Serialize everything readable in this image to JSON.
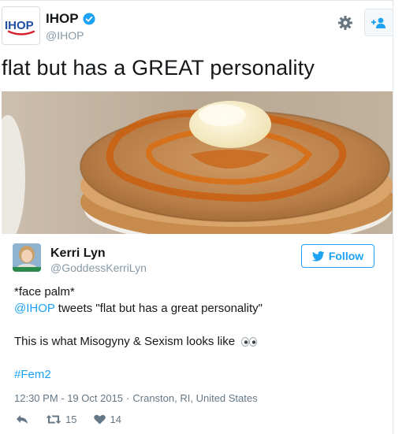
{
  "tweet": {
    "author_name": "IHOP",
    "author_handle": "@IHOP",
    "logo_text": "IHOP",
    "text": "flat but has a GREAT personality",
    "image": "pancake stack with syrup and butter",
    "icons": {
      "settings": "gear-icon",
      "follow": "follow-user-icon",
      "verified": "verified-badge-icon"
    }
  },
  "reply": {
    "author_name": "Kerri Lyn",
    "author_handle": "@GoddessKerriLyn",
    "follow_label": "Follow",
    "line1": "*face palm*",
    "mention": "@IHOP",
    "line2_rest": " tweets \"flat but has a great personality\"",
    "line3": "This is what Misogyny & Sexism looks like",
    "line3_emoji": "eyes-emoji",
    "hashtag": "#Fem2",
    "time": "12:30 PM - 19 Oct 2015",
    "separator": "·",
    "location": "Cranston, RI, United States",
    "retweets": "15",
    "likes": "14",
    "colors": {
      "link": "#1da1f2",
      "meta": "#657786"
    }
  }
}
